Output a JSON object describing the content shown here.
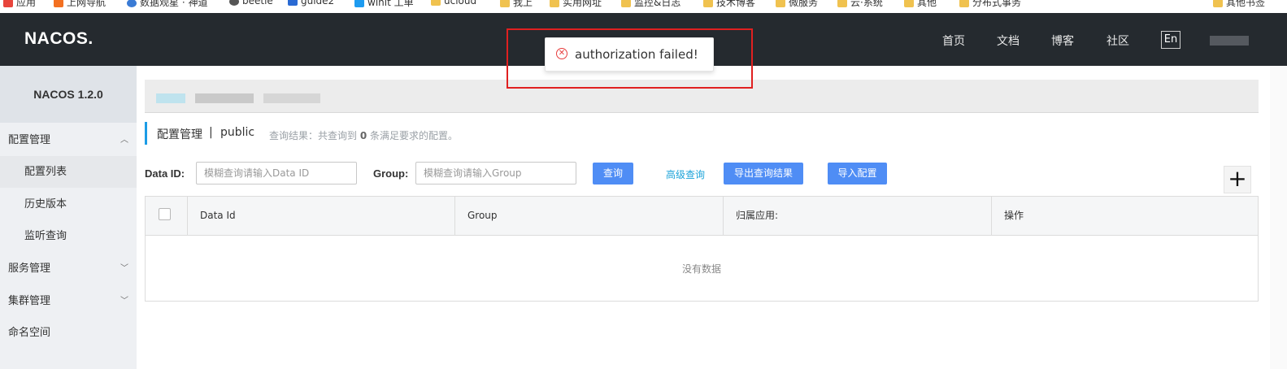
{
  "bookmarks": [
    {
      "label": "应用"
    },
    {
      "label": "上网导航"
    },
    {
      "label": "数据观星 · 神道"
    },
    {
      "label": "beetle"
    },
    {
      "label": "guide2"
    },
    {
      "label": "winit 工单"
    },
    {
      "label": "ucloud"
    },
    {
      "label": "我上"
    },
    {
      "label": "实用网址"
    },
    {
      "label": "监控&日志"
    },
    {
      "label": "技术博客"
    },
    {
      "label": "微服务"
    },
    {
      "label": "云·系统"
    },
    {
      "label": "其他"
    },
    {
      "label": "分布式事务"
    },
    {
      "label": "其他书签"
    }
  ],
  "header": {
    "logo": "NACOS.",
    "nav": [
      "首页",
      "文档",
      "博客",
      "社区"
    ],
    "lang": "En"
  },
  "sidebar": {
    "version": "NACOS 1.2.0",
    "items": [
      {
        "label": "配置管理"
      },
      {
        "label": "配置列表"
      },
      {
        "label": "历史版本"
      },
      {
        "label": "监听查询"
      },
      {
        "label": "服务管理"
      },
      {
        "label": "集群管理"
      },
      {
        "label": "命名空间"
      }
    ]
  },
  "main": {
    "title": "配置管理",
    "separator": "|",
    "namespace": "public",
    "summary_prefix": "查询结果：共查询到",
    "summary_count": "0",
    "summary_suffix": "条满足要求的配置。"
  },
  "form": {
    "dataid_label": "Data ID:",
    "dataid_placeholder": "模糊查询请输入Data ID",
    "group_label": "Group:",
    "group_placeholder": "模糊查询请输入Group",
    "query_button": "查询",
    "advanced_link": "高级查询",
    "export_button": "导出查询结果",
    "import_button": "导入配置",
    "add_button": "+"
  },
  "table": {
    "columns": [
      "Data Id",
      "Group",
      "归属应用:",
      "操作"
    ],
    "empty_text": "没有数据"
  },
  "toast": {
    "message": "authorization failed!",
    "icon": "error-circle-icon",
    "icon_glyph": "✕"
  },
  "colors": {
    "header_bg": "#252a2f",
    "primary_button": "#4f8df5",
    "link": "#1ba3d9",
    "error": "#e73c3c",
    "highlight_border": "#e02020"
  }
}
